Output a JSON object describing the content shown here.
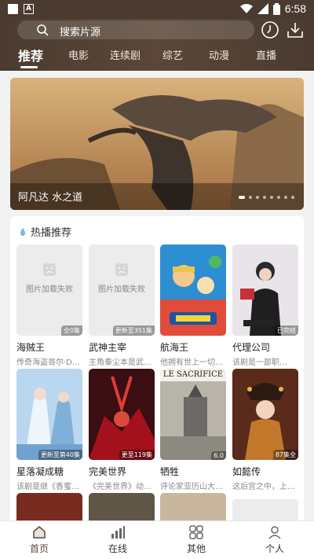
{
  "status_bar": {
    "time": "6:58"
  },
  "search": {
    "placeholder": "搜索片源"
  },
  "tabs": [
    "推荐",
    "电影",
    "连续剧",
    "综艺",
    "动漫",
    "直播"
  ],
  "banner": {
    "title": "阿凡达 水之道",
    "dots": 8,
    "active_dot": 0
  },
  "section": {
    "title": "热播推荐"
  },
  "load_fail_text": "图片加载失败",
  "items": [
    {
      "name": "海贼王",
      "desc": "传奇海盗哥尔·D·罗杰…",
      "badge": "全0集",
      "image": "fail"
    },
    {
      "name": "武神主宰",
      "desc": "主角秦尘本是武域…",
      "badge": "更新至351集",
      "image": "fail"
    },
    {
      "name": "航海王",
      "desc": "他拥有世上一切财…",
      "badge": "",
      "image": "onepiece"
    },
    {
      "name": "代理公司",
      "desc": "该剧是一部职…",
      "badge": "已完结",
      "image": "agency"
    },
    {
      "name": "星落凝成糖",
      "desc": "该剧是继《香蜜沉…",
      "badge": "更新至第40集",
      "image": "sugar"
    },
    {
      "name": "完美世界",
      "desc": "《完美世界》动画…",
      "badge": "更至119集",
      "image": "perfect"
    },
    {
      "name": "牺牲",
      "desc": "评论家亚历山大（…",
      "badge": "6.0",
      "image": "sacrifice",
      "poster_text": "LE SACRIFICE"
    },
    {
      "name": "如懿传",
      "desc": "这后宫之中，上演…",
      "badge": "87集全",
      "image": "ruyi"
    }
  ],
  "bottom_nav": [
    {
      "label": "首页",
      "icon": "home-icon",
      "active": true
    },
    {
      "label": "在线",
      "icon": "chart-bars-icon",
      "active": false
    },
    {
      "label": "其他",
      "icon": "grid-icon",
      "active": false
    },
    {
      "label": "个人",
      "icon": "person-icon",
      "active": false
    }
  ],
  "colors": {
    "header": "#4b3b30",
    "accent": "#5c4a3c"
  }
}
